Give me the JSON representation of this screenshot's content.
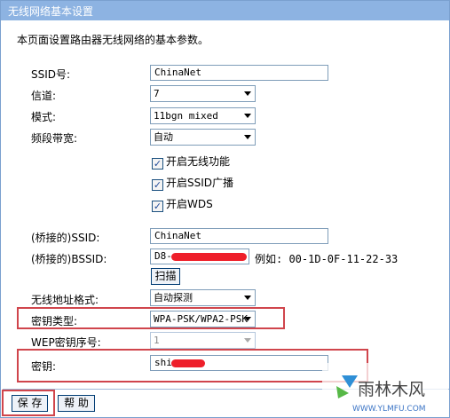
{
  "window": {
    "title": "无线网络基本设置"
  },
  "intro": "本页面设置路由器无线网络的基本参数。",
  "fields": {
    "ssid": {
      "label": "SSID号:",
      "value": "ChinaNet"
    },
    "channel": {
      "label": "信道:",
      "value": "7"
    },
    "mode": {
      "label": "模式:",
      "value": "11bgn mixed"
    },
    "bandwidth": {
      "label": "频段带宽:",
      "value": "自动"
    },
    "bridge_ssid": {
      "label": "(桥接的)SSID:",
      "value": "ChinaNet"
    },
    "bridge_bssid": {
      "label": "(桥接的)BSSID:",
      "value": "D8-",
      "example": "例如: 00-1D-0F-11-22-33"
    },
    "addr_format": {
      "label": "无线地址格式:",
      "value": "自动探测"
    },
    "key_type": {
      "label": "密钥类型:",
      "value": "WPA-PSK/WPA2-PSK"
    },
    "wep_index": {
      "label": "WEP密钥序号:",
      "value": "1"
    },
    "key": {
      "label": "密钥:",
      "value": "shi"
    }
  },
  "checkboxes": [
    {
      "label": "开启无线功能",
      "checked": true
    },
    {
      "label": "开启SSID广播",
      "checked": true
    },
    {
      "label": "开启WDS",
      "checked": true
    }
  ],
  "buttons": {
    "scan": "扫描",
    "save": "保 存",
    "help": "帮 助"
  },
  "watermark": {
    "brand": "雨林木风",
    "url": "WWW.YLMFU.COM"
  },
  "colors": {
    "titlebar": "#8db3e2",
    "highlight": "#d0454c"
  }
}
